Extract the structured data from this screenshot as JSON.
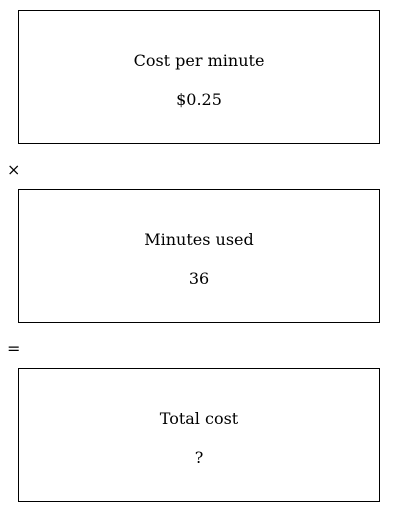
{
  "boxes": [
    {
      "label": "Cost per minute",
      "value": "$0.25"
    },
    {
      "label": "Minutes used",
      "value": "36"
    },
    {
      "label": "Total cost",
      "value": "?"
    }
  ],
  "operators": [
    "×",
    "="
  ]
}
